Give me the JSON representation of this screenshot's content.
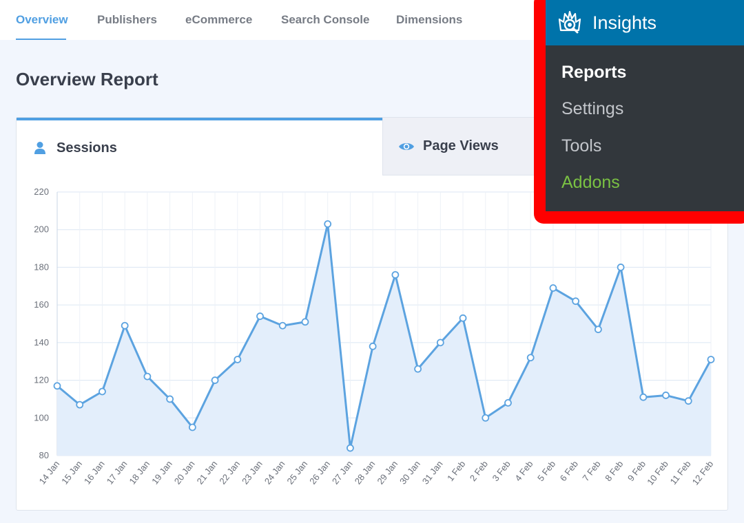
{
  "nav": {
    "tabs": [
      {
        "label": "Overview",
        "active": true
      },
      {
        "label": "Publishers",
        "active": false
      },
      {
        "label": "eCommerce",
        "active": false
      },
      {
        "label": "Search Console",
        "active": false
      },
      {
        "label": "Dimensions",
        "active": false
      }
    ]
  },
  "page": {
    "title": "Overview Report"
  },
  "report": {
    "tabs": [
      {
        "label": "Sessions",
        "icon": "user-icon",
        "active": true
      },
      {
        "label": "Page Views",
        "icon": "eye-icon",
        "active": false
      }
    ]
  },
  "menu": {
    "title": "Insights",
    "icon": "insights-logo-icon",
    "items": [
      {
        "label": "Reports",
        "state": "current"
      },
      {
        "label": "Settings",
        "state": "normal"
      },
      {
        "label": "Tools",
        "state": "normal"
      },
      {
        "label": "Addons",
        "state": "highlight"
      }
    ]
  },
  "colors": {
    "accent": "#509fe2",
    "menu_header": "#0073aa",
    "menu_bg": "#32373c",
    "addons": "#7ac143",
    "highlight_frame": "#ff0000",
    "line": "#5ca3e0",
    "area": "#e3eefb"
  },
  "chart_data": {
    "type": "area",
    "x": [
      "14 Jan",
      "15 Jan",
      "16 Jan",
      "17 Jan",
      "18 Jan",
      "19 Jan",
      "20 Jan",
      "21 Jan",
      "22 Jan",
      "23 Jan",
      "24 Jan",
      "25 Jan",
      "26 Jan",
      "27 Jan",
      "28 Jan",
      "29 Jan",
      "30 Jan",
      "31 Jan",
      "1 Feb",
      "2 Feb",
      "3 Feb",
      "4 Feb",
      "5 Feb",
      "6 Feb",
      "7 Feb",
      "8 Feb",
      "9 Feb",
      "10 Feb",
      "11 Feb",
      "12 Feb"
    ],
    "series": [
      {
        "values": [
          117,
          107,
          114,
          149,
          122,
          110,
          95,
          120,
          131,
          154,
          149,
          151,
          203,
          84,
          138,
          176,
          126,
          140,
          153,
          100,
          108,
          132,
          169,
          162,
          147,
          180,
          111,
          112,
          109,
          131
        ]
      }
    ],
    "ylim": [
      80,
      220
    ],
    "yticks": [
      "220",
      "200",
      "180",
      "160",
      "140",
      "120",
      "100",
      "80"
    ],
    "grid": true,
    "legend": "none"
  }
}
